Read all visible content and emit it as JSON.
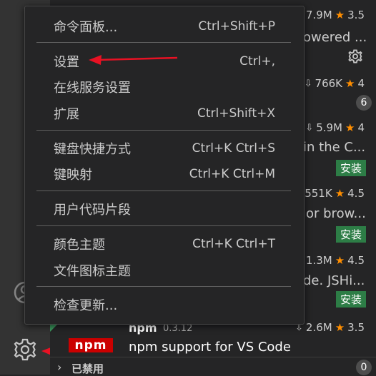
{
  "menu": {
    "items": [
      {
        "label": "命令面板...",
        "shortcut": "Ctrl+Shift+P"
      },
      {
        "label": "设置",
        "shortcut": "Ctrl+,"
      },
      {
        "label": "在线服务设置",
        "shortcut": ""
      },
      {
        "label": "扩展",
        "shortcut": "Ctrl+Shift+X"
      },
      {
        "label": "键盘快捷方式",
        "shortcut": "Ctrl+K Ctrl+S"
      },
      {
        "label": "键映射",
        "shortcut": "Ctrl+K Ctrl+M"
      },
      {
        "label": "用户代码片段",
        "shortcut": ""
      },
      {
        "label": "颜色主题",
        "shortcut": "Ctrl+K Ctrl+T"
      },
      {
        "label": "文件图标主题",
        "shortcut": ""
      },
      {
        "label": "检查更新...",
        "shortcut": ""
      }
    ]
  },
  "extensions": [
    {
      "downloads": "7.9M",
      "rating": "3.5",
      "desc": "owered ...",
      "action": "gear"
    },
    {
      "downloads": "766K",
      "rating": "4",
      "desc": "",
      "action": "none"
    },
    {
      "downloads": "5.9M",
      "rating": "4",
      "desc": "in the C...",
      "action": "安装"
    },
    {
      "downloads": "551K",
      "rating": "4.5",
      "desc": "or brow...",
      "action": "安装"
    },
    {
      "downloads": "1.3M",
      "rating": "4.5",
      "desc": "de. JSHi...",
      "action": "安装"
    }
  ],
  "badge_count": "6",
  "npm": {
    "logo": "npm",
    "name": "npm",
    "version": "0.3.12",
    "desc": "npm support for VS Code",
    "downloads": "2.6M",
    "rating": "3.5"
  },
  "disabled_section": {
    "label": "已禁用",
    "count": "0"
  },
  "colors": {
    "arrow": "#e81123",
    "install": "#2d7d46",
    "star": "#ff8e00"
  }
}
